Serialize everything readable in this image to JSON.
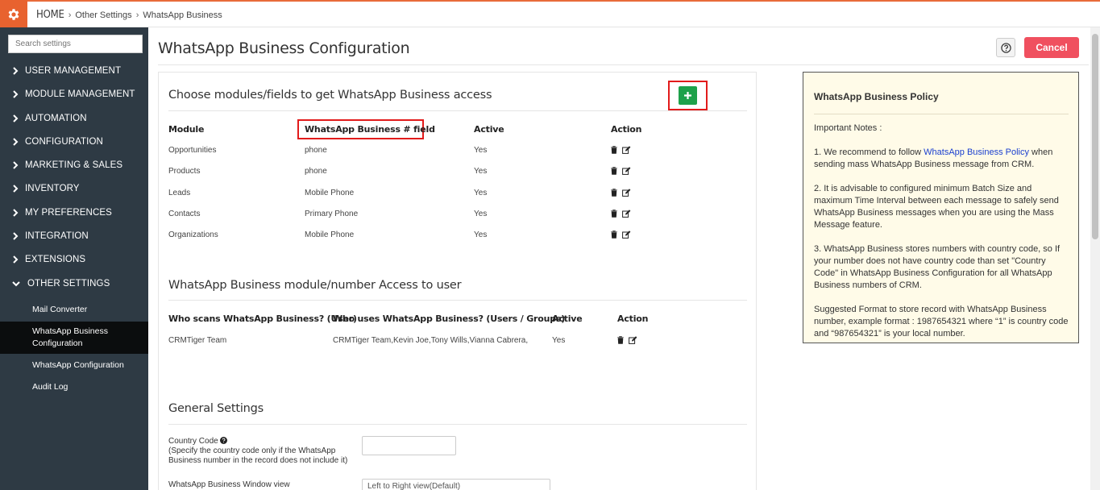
{
  "breadcrumb": {
    "home": "HOME",
    "level1": "Other Settings",
    "level2": "WhatsApp Business"
  },
  "sidebar": {
    "search_placeholder": "Search settings",
    "items": [
      {
        "label": "USER MANAGEMENT",
        "expanded": false
      },
      {
        "label": "MODULE MANAGEMENT",
        "expanded": false
      },
      {
        "label": "AUTOMATION",
        "expanded": false
      },
      {
        "label": "CONFIGURATION",
        "expanded": false
      },
      {
        "label": "MARKETING & SALES",
        "expanded": false
      },
      {
        "label": "INVENTORY",
        "expanded": false
      },
      {
        "label": "MY PREFERENCES",
        "expanded": false
      },
      {
        "label": "INTEGRATION",
        "expanded": false
      },
      {
        "label": "EXTENSIONS",
        "expanded": false
      },
      {
        "label": "OTHER SETTINGS",
        "expanded": true
      }
    ],
    "sub_items": [
      {
        "label": "Mail Converter",
        "active": false
      },
      {
        "label": "WhatsApp Business Configuration",
        "active": true
      },
      {
        "label": "WhatsApp Configuration",
        "active": false
      },
      {
        "label": "Audit Log",
        "active": false
      }
    ]
  },
  "header": {
    "title": "WhatsApp Business Configuration",
    "cancel_label": "Cancel"
  },
  "modules_section": {
    "title": "Choose modules/fields to get WhatsApp Business access",
    "columns": [
      "Module",
      "WhatsApp Business # field",
      "Active",
      "Action"
    ],
    "rows": [
      {
        "module": "Opportunities",
        "field": "phone",
        "active": "Yes"
      },
      {
        "module": "Products",
        "field": "phone",
        "active": "Yes"
      },
      {
        "module": "Leads",
        "field": "Mobile Phone",
        "active": "Yes"
      },
      {
        "module": "Contacts",
        "field": "Primary Phone",
        "active": "Yes"
      },
      {
        "module": "Organizations",
        "field": "Mobile Phone",
        "active": "Yes"
      }
    ]
  },
  "access_section": {
    "title": "WhatsApp Business module/number Access to user",
    "columns": [
      "Who scans WhatsApp Business? (User)",
      "Who uses WhatsApp Business? (Users / Groups)",
      "Active",
      "Action"
    ],
    "rows": [
      {
        "scanner": "CRMTiger Team",
        "users": "CRMTiger Team,Kevin Joe,Tony Wills,Vianna Cabrera,",
        "active": "Yes"
      }
    ]
  },
  "general_section": {
    "title": "General Settings",
    "country_code_label": "Country Code",
    "country_code_hint": "(Specify the country code only if the WhatsApp Business number in the record does not include it)",
    "country_code_value": "",
    "window_view_label": "WhatsApp Business Window view",
    "window_view_value": "Left to Right view(Default)"
  },
  "policy": {
    "title": "WhatsApp Business Policy",
    "notes_heading": "Important Notes :",
    "note1_pre": "1. We recommend to follow ",
    "note1_link": "WhatsApp Business Policy",
    "note1_post": " when sending mass WhatsApp Business message from CRM.",
    "note2": "2. It is advisable to configured minimum Batch Size and maximum Time Interval between each message to safely send WhatsApp Business messages when you are using the Mass Message feature.",
    "note3": "3. WhatsApp Business stores numbers with country code, so If your number does not have country code than set \"Country Code\" in WhatsApp Business Configuration for all WhatsApp Business numbers of CRM.",
    "note4": "Suggested Format to store record with WhatsApp Business number, example format : 1987654321 where “1” is country code and “987654321” is your local number."
  },
  "colors": {
    "accent": "#e8622f",
    "cancel": "#f0505f",
    "add": "#1ea14a",
    "highlight": "#e21b1b",
    "sidebar": "#2e3a44"
  }
}
